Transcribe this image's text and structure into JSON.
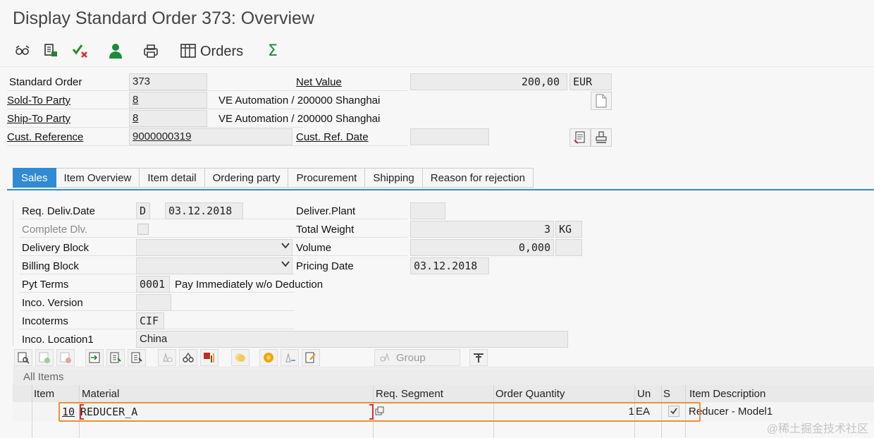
{
  "window": {
    "title": "Display Standard Order 373: Overview"
  },
  "toolbar": {
    "orders_label": "Orders"
  },
  "header": {
    "standard_order_label": "Standard Order",
    "standard_order_value": "373",
    "net_value_label": "Net Value",
    "net_value": "200,00",
    "currency": "EUR",
    "sold_to_label": "Sold-To Party",
    "sold_to_value": "8",
    "sold_to_desc": "VE Automation / 200000 Shanghai",
    "ship_to_label": "Ship-To Party",
    "ship_to_value": "8",
    "ship_to_desc": "VE Automation / 200000 Shanghai",
    "cust_ref_label": "Cust. Reference",
    "cust_ref_value": "9000000319",
    "cust_ref_date_label": "Cust. Ref. Date",
    "cust_ref_date_value": ""
  },
  "tabs": [
    {
      "label": "Sales",
      "active": true
    },
    {
      "label": "Item Overview"
    },
    {
      "label": "Item detail"
    },
    {
      "label": "Ordering party"
    },
    {
      "label": "Procurement"
    },
    {
      "label": "Shipping"
    },
    {
      "label": "Reason for rejection"
    }
  ],
  "sales": {
    "req_deliv_label": "Req. Deliv.Date",
    "req_deliv_type": "D",
    "req_deliv_date": "03.12.2018",
    "complete_dlv_label": "Complete Dlv.",
    "delivery_block_label": "Delivery Block",
    "billing_block_label": "Billing Block",
    "pyt_terms_label": "Pyt Terms",
    "pyt_terms_value": "0001",
    "pyt_terms_desc": "Pay Immediately w/o Deduction",
    "inco_version_label": "Inco. Version",
    "incoterms_label": "Incoterms",
    "incoterms_value": "CIF",
    "inco_location_label": "Inco. Location1",
    "inco_location_value": "China",
    "deliver_plant_label": "Deliver.Plant",
    "total_weight_label": "Total Weight",
    "total_weight_value": "3",
    "total_weight_unit": "KG",
    "volume_label": "Volume",
    "volume_value": "0,000",
    "pricing_date_label": "Pricing Date",
    "pricing_date_value": "03.12.2018"
  },
  "grid_toolbar": {
    "group_label": "Group"
  },
  "items": {
    "section_title": "All Items",
    "columns": {
      "item": "Item",
      "material": "Material",
      "req_segment": "Req. Segment",
      "order_quantity": "Order Quantity",
      "un": "Un",
      "s": "S",
      "item_description": "Item Description"
    },
    "rows": [
      {
        "item": "10",
        "material": "REDUCER_A",
        "req_segment": "",
        "order_quantity": "1",
        "un": "EA",
        "s_checked": true,
        "item_description": "Reducer - Model1"
      }
    ]
  },
  "watermark": "@稀土掘金技术社区",
  "colors": {
    "accent": "#2f8bd2",
    "highlight": "#e8923b"
  }
}
